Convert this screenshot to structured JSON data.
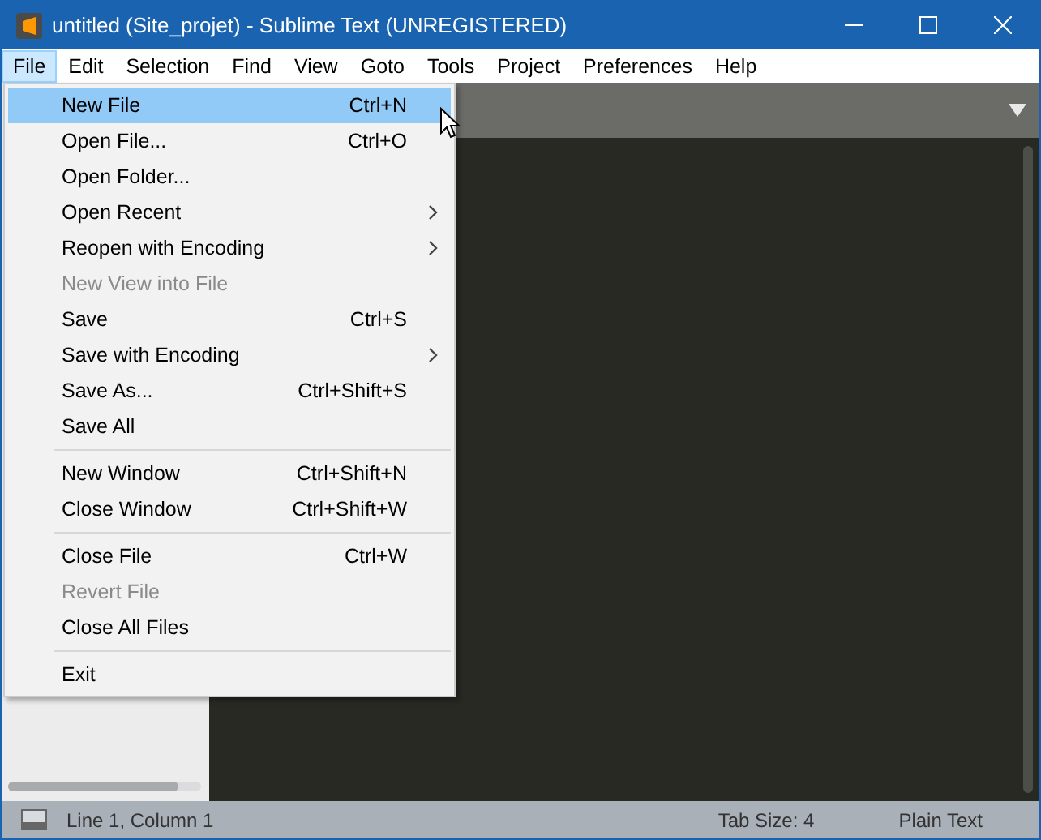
{
  "window": {
    "title": "untitled (Site_projet) - Sublime Text (UNREGISTERED)"
  },
  "menubar": [
    {
      "label": "File",
      "selected": true
    },
    {
      "label": "Edit",
      "selected": false
    },
    {
      "label": "Selection",
      "selected": false
    },
    {
      "label": "Find",
      "selected": false
    },
    {
      "label": "View",
      "selected": false
    },
    {
      "label": "Goto",
      "selected": false
    },
    {
      "label": "Tools",
      "selected": false
    },
    {
      "label": "Project",
      "selected": false
    },
    {
      "label": "Preferences",
      "selected": false
    },
    {
      "label": "Help",
      "selected": false
    }
  ],
  "file_menu": [
    {
      "kind": "item",
      "label": "New File",
      "shortcut": "Ctrl+N",
      "selected": true,
      "disabled": false
    },
    {
      "kind": "item",
      "label": "Open File...",
      "shortcut": "Ctrl+O",
      "selected": false,
      "disabled": false
    },
    {
      "kind": "item",
      "label": "Open Folder...",
      "selected": false,
      "disabled": false
    },
    {
      "kind": "submenu",
      "label": "Open Recent",
      "selected": false,
      "disabled": false
    },
    {
      "kind": "submenu",
      "label": "Reopen with Encoding",
      "selected": false,
      "disabled": false
    },
    {
      "kind": "item",
      "label": "New View into File",
      "selected": false,
      "disabled": true
    },
    {
      "kind": "item",
      "label": "Save",
      "shortcut": "Ctrl+S",
      "selected": false,
      "disabled": false
    },
    {
      "kind": "submenu",
      "label": "Save with Encoding",
      "selected": false,
      "disabled": false
    },
    {
      "kind": "item",
      "label": "Save As...",
      "shortcut": "Ctrl+Shift+S",
      "selected": false,
      "disabled": false
    },
    {
      "kind": "item",
      "label": "Save All",
      "selected": false,
      "disabled": false
    },
    {
      "kind": "separator"
    },
    {
      "kind": "item",
      "label": "New Window",
      "shortcut": "Ctrl+Shift+N",
      "selected": false,
      "disabled": false
    },
    {
      "kind": "item",
      "label": "Close Window",
      "shortcut": "Ctrl+Shift+W",
      "selected": false,
      "disabled": false
    },
    {
      "kind": "separator"
    },
    {
      "kind": "item",
      "label": "Close File",
      "shortcut": "Ctrl+W",
      "selected": false,
      "disabled": false
    },
    {
      "kind": "item",
      "label": "Revert File",
      "selected": false,
      "disabled": true
    },
    {
      "kind": "item",
      "label": "Close All Files",
      "selected": false,
      "disabled": false
    },
    {
      "kind": "separator"
    },
    {
      "kind": "item",
      "label": "Exit",
      "selected": false,
      "disabled": false
    }
  ],
  "status_bar": {
    "position": "Line 1, Column 1",
    "tab_size": "Tab Size: 4",
    "syntax": "Plain Text"
  }
}
